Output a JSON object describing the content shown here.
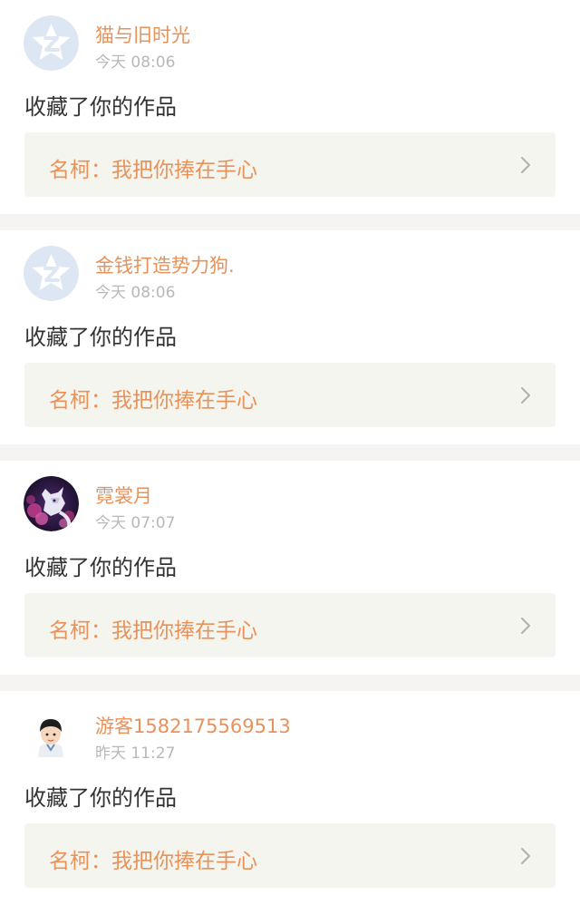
{
  "notifications": [
    {
      "username": "猫与旧时光",
      "time": "今天 08:06",
      "action": "收藏了你的作品",
      "work_title": "名柯：我把你捧在手心",
      "avatar": "default-star-avatar-icon"
    },
    {
      "username": "金钱打造势力狗.",
      "time": "今天 08:06",
      "action": "收藏了你的作品",
      "work_title": "名柯：我把你捧在手心",
      "avatar": "default-star-avatar-icon"
    },
    {
      "username": "霓裳月",
      "time": "今天 07:07",
      "action": "收藏了你的作品",
      "work_title": "名柯：我把你捧在手心",
      "avatar": "fox-illustration-avatar"
    },
    {
      "username": "游客1582175569513",
      "time": "昨天 11:27",
      "action": "收藏了你的作品",
      "work_title": "名柯：我把你捧在手心",
      "avatar": "cartoon-boy-avatar"
    }
  ],
  "colors": {
    "accent": "#e8925a",
    "time": "#b8b8b8",
    "text": "#333333",
    "work_box": "#f5f5ef",
    "separator": "#f5f4f3"
  },
  "icons": {
    "chevron": "chevron-right-icon"
  }
}
